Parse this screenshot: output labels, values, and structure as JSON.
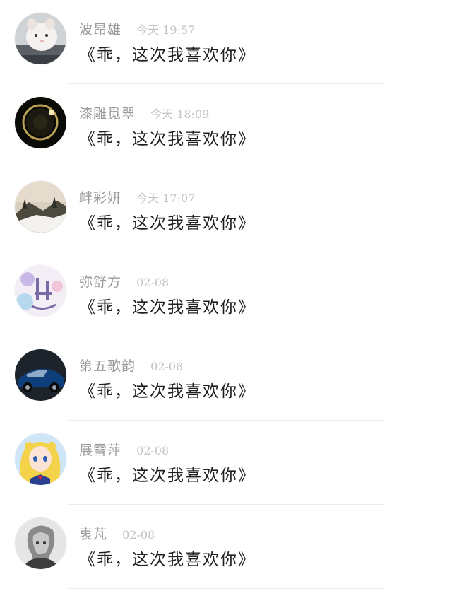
{
  "items": [
    {
      "name": "波昂雄",
      "time": "今天 19:57",
      "message": "《乖，这次我喜欢你》",
      "avatar": "hamster-avatar"
    },
    {
      "name": "漆雕觅翠",
      "time": "今天 18:09",
      "message": "《乖，这次我喜欢你》",
      "avatar": "dark-ring-avatar"
    },
    {
      "name": "衅彩妍",
      "time": "今天 17:07",
      "message": "《乖，这次我喜欢你》",
      "avatar": "snow-landscape-avatar"
    },
    {
      "name": "弥舒方",
      "time": "02-08",
      "message": "《乖，这次我喜欢你》",
      "avatar": "rocking-chair-avatar"
    },
    {
      "name": "第五歌韵",
      "time": "02-08",
      "message": "《乖，这次我喜欢你》",
      "avatar": "car-avatar"
    },
    {
      "name": "展雪萍",
      "time": "02-08",
      "message": "《乖，这次我喜欢你》",
      "avatar": "anime-girl-avatar"
    },
    {
      "name": "衷芃",
      "time": "02-08",
      "message": "《乖，这次我喜欢你》",
      "avatar": "portrait-sketch-avatar"
    }
  ]
}
